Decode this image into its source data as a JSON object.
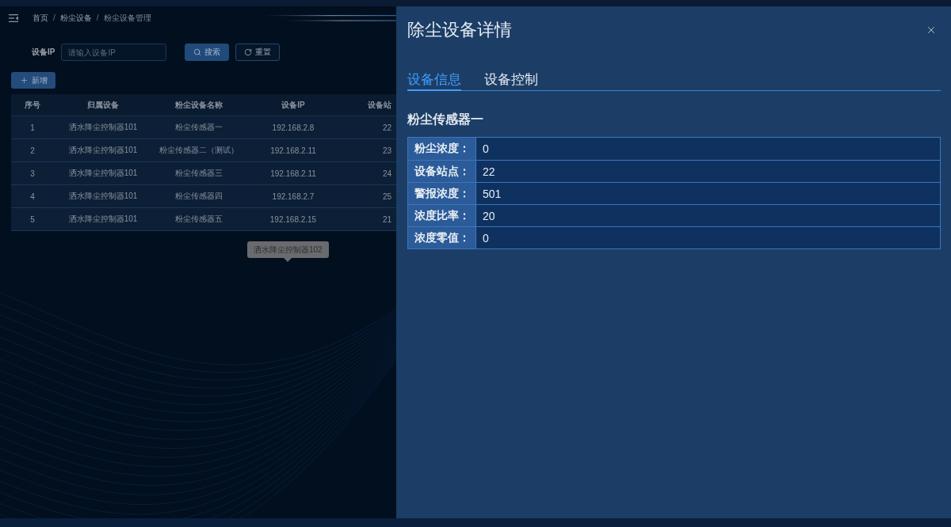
{
  "breadcrumb": [
    {
      "kind": "link",
      "text": "首页"
    },
    {
      "kind": "separator",
      "text": "/"
    },
    {
      "kind": "link",
      "text": "粉尘设备"
    },
    {
      "kind": "separator",
      "text": "/"
    },
    {
      "kind": "current",
      "text": "粉尘设备管理"
    }
  ],
  "search": {
    "label": "设备IP",
    "placeholder": "请输入设备IP",
    "buttons": [
      {
        "kind": "search",
        "label": "搜索"
      },
      {
        "kind": "reset",
        "label": "重置"
      }
    ]
  },
  "add_button": {
    "label": "新增"
  },
  "table": {
    "columns": [
      "序号",
      "归属设备",
      "粉尘设备名称",
      "设备IP",
      "设备站"
    ],
    "rows": [
      [
        "1",
        "洒水降尘控制器101",
        "粉尘传感器一",
        "192.168.2.8",
        "22"
      ],
      [
        "2",
        "洒水降尘控制器101",
        "粉尘传感器二（测试）",
        "192.168.2.11",
        "23"
      ],
      [
        "3",
        "洒水降尘控制器101",
        "粉尘传感器三",
        "192.168.2.11",
        "24"
      ],
      [
        "4",
        "洒水降尘控制器101",
        "粉尘传感器四",
        "192.168.2.7",
        "25"
      ],
      [
        "5",
        "洒水降尘控制器101",
        "粉尘传感器五",
        "192.168.2.15",
        "21"
      ]
    ]
  },
  "tooltip": {
    "text": "洒水降尘控制器102"
  },
  "drawer": {
    "title": "除尘设备详情",
    "tabs": [
      {
        "label": "设备信息",
        "selected": true
      },
      {
        "label": "设备控制",
        "selected": false
      }
    ],
    "section_title": "粉尘传感器一",
    "fields": [
      {
        "label": "粉尘浓度：",
        "value": "0"
      },
      {
        "label": "设备站点：",
        "value": "22"
      },
      {
        "label": "警报浓度：",
        "value": "501"
      },
      {
        "label": "浓度比率：",
        "value": "20"
      },
      {
        "label": "浓度零值：",
        "value": "0"
      }
    ]
  }
}
